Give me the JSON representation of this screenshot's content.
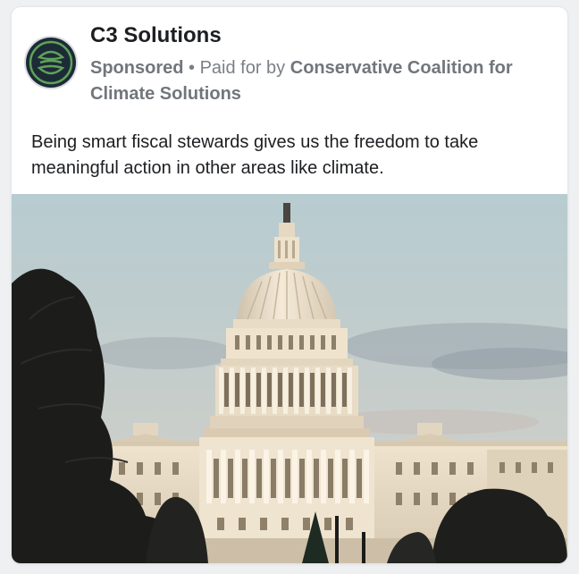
{
  "post": {
    "page_name": "C3 Solutions",
    "sponsored_label": "Sponsored",
    "separator": " • ",
    "paid_for_prefix": "Paid for by ",
    "sponsor_name": "Conservative Coalition for Climate Solutions",
    "body_text": "Being smart fiscal stewards gives us the freedom to take meaningful action in other areas like climate."
  },
  "avatar": {
    "icon": "leaf-circle-logo-icon",
    "colors": {
      "background": "#1d2b36",
      "mark": "#5fa35a"
    }
  },
  "image": {
    "subject": "us-capitol-building-photo",
    "colors": {
      "sky_top": "#b8cdd1",
      "sky_bottom": "#d6d0c8",
      "building": "#efe3cf",
      "trees": "#1b1c1a"
    }
  }
}
